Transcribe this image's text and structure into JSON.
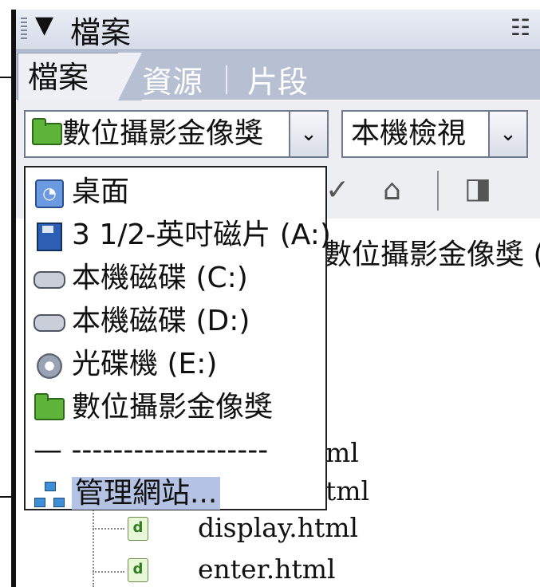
{
  "panel": {
    "title": "檔案",
    "collapse_glyph": "▼",
    "options_glyph": "☷"
  },
  "tabs": [
    {
      "label": "檔案",
      "active": true
    },
    {
      "label": "資源",
      "active": false
    },
    {
      "label": "片段",
      "active": false
    }
  ],
  "toolbar": {
    "site_select_value": "數位攝影金像獎",
    "view_select_value": "本機檢視",
    "dropdown_glyph": "⌄"
  },
  "dropdown": {
    "items": [
      {
        "label": "桌面",
        "icon": "desktop-icon",
        "highlighted": false
      },
      {
        "label": "3 1/2-英吋磁片 (A:)",
        "icon": "floppy-icon",
        "highlighted": false
      },
      {
        "label": "本機磁碟 (C:)",
        "icon": "hard-disk-icon",
        "highlighted": false
      },
      {
        "label": "本機磁碟 (D:)",
        "icon": "hard-disk-icon",
        "highlighted": false
      },
      {
        "label": "光碟機 (E:)",
        "icon": "cd-drive-icon",
        "highlighted": false
      },
      {
        "label": "數位攝影金像獎",
        "icon": "folder-icon",
        "highlighted": false
      },
      {
        "label": "— -------------------",
        "icon": "",
        "highlighted": false
      },
      {
        "label": "管理網站...",
        "icon": "manage-sites-icon",
        "highlighted": true
      }
    ]
  },
  "tree": {
    "root_label": "數位攝影金像獎 (D",
    "files": [
      {
        "name": "ml"
      },
      {
        "name": "tml"
      },
      {
        "name": "display.html"
      },
      {
        "name": "enter.html"
      }
    ]
  },
  "colors": {
    "tab_row": "#b7c0d3",
    "highlight": "#b4c3e4",
    "folder_green": "#5fb53a"
  }
}
